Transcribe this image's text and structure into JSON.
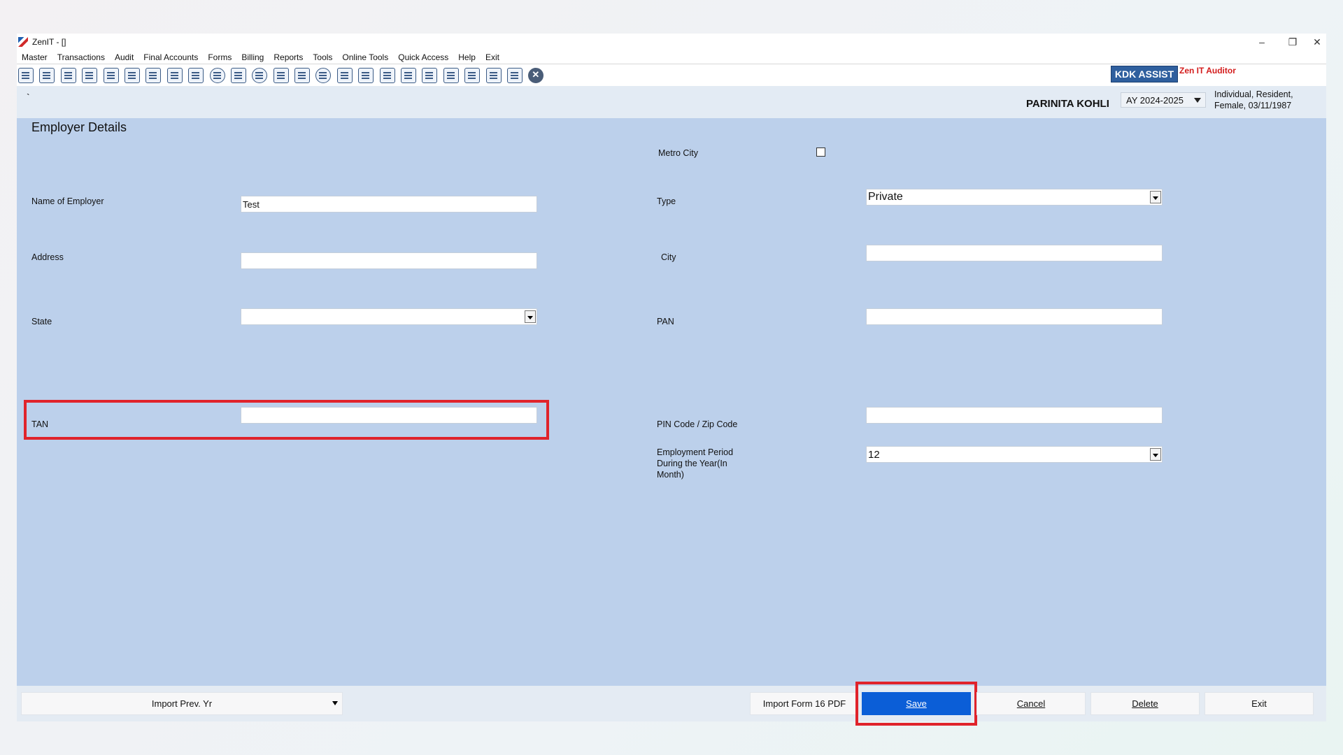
{
  "window": {
    "title": "ZenIT - []"
  },
  "window_controls": {
    "minimize": "–",
    "restore": "❐",
    "close": "✕"
  },
  "menu": [
    "Master",
    "Transactions",
    "Audit",
    "Final Accounts",
    "Forms",
    "Billing",
    "Reports",
    "Tools",
    "Online Tools",
    "Quick Access",
    "Help",
    "Exit"
  ],
  "toolbar": {
    "icons": [
      "report-icon",
      "home-icon",
      "building-icon",
      "bar-chart-icon",
      "gift-icon",
      "people-icon",
      "gavel-icon",
      "funnel-icon",
      "tax-icon",
      "disc-icon",
      "calculator-icon",
      "pie-chart-icon",
      "pay-icon",
      "book-icon",
      "info-icon",
      "form-icon",
      "search-doc-icon",
      "calendar-icon",
      "shield-icon",
      "refresh-icon",
      "bs-icon",
      "bank-icon",
      "3cd-icon",
      "document-icon",
      "close-circle-icon"
    ]
  },
  "branding": {
    "kdk": "KDK ASSIST",
    "product": "Zen IT Auditor"
  },
  "infobar": {
    "marker": "`",
    "person_name": "PARINITA  KOHLI",
    "assessment_year": "AY 2024-2025",
    "person_desc_line1": "Individual, Resident,",
    "person_desc_line2": "Female, 03/11/1987"
  },
  "form": {
    "heading": "Employer Details",
    "metro_city_label": "Metro City",
    "metro_city_checked": false,
    "name_of_employer_label": "Name of Employer",
    "name_of_employer_value": "Test",
    "type_label": "Type",
    "type_value": "Private",
    "address_label": "Address",
    "address_value": "",
    "city_label": "City",
    "city_value": "",
    "state_label": "State",
    "state_value": "",
    "pan_label": "PAN",
    "pan_value": "",
    "tan_label": "TAN",
    "tan_value": "",
    "pin_label": "PIN Code / Zip Code",
    "pin_value": "",
    "employment_period_label_1": "Employment Period",
    "employment_period_label_2": "During the Year(In",
    "employment_period_label_3": "Month)",
    "employment_period_value": "12"
  },
  "footer": {
    "import_prev_yr": "Import Prev. Yr",
    "import_form16": "Import Form 16 PDF",
    "save": "Save",
    "cancel": "Cancel",
    "delete": "Delete",
    "exit": "Exit"
  },
  "colors": {
    "content_bg": "#bcd0eb",
    "primary_button": "#0b5ed7",
    "highlight": "#e0232b",
    "brand_red": "#d31c1c"
  }
}
